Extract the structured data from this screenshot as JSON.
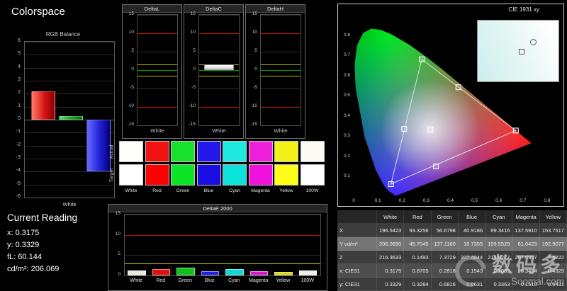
{
  "app": {
    "title": "Colorspace"
  },
  "rgb_balance": {
    "title": "RGB Balance",
    "xlabel": "White",
    "ylim": [
      -6,
      6
    ],
    "ticks": [
      6,
      5,
      4,
      3,
      2,
      1,
      0,
      -1,
      -2,
      -3,
      -4,
      -5,
      -6
    ],
    "bars": [
      {
        "name": "red",
        "value": 2.2,
        "color": "#d81414",
        "color_light": "#ff7a6a",
        "color_dark": "#8a0000"
      },
      {
        "name": "green",
        "value": 0.3,
        "color": "#0ea21a",
        "color_light": "#5ae05a",
        "color_dark": "#046a0c"
      },
      {
        "name": "blue",
        "value": -4.0,
        "color": "#2222d8",
        "color_light": "#6a6aff",
        "color_dark": "#000078"
      }
    ]
  },
  "current_reading": {
    "title": "Current Reading",
    "lines": [
      "x: 0.3175",
      "y: 0.3329",
      "fL: 60.144",
      "cd/m²: 206.069"
    ]
  },
  "delta_scale": {
    "ticks": [
      15,
      10,
      5,
      0,
      -5,
      -10,
      -15
    ],
    "red_lines": [
      10,
      -10
    ],
    "yellow_lines": [
      1.5,
      -1.5
    ],
    "green_lines": [
      0
    ]
  },
  "delta_charts": [
    {
      "title": "DeltaL",
      "xlabel": "White",
      "value": 0
    },
    {
      "title": "DeltaC",
      "xlabel": "White",
      "value": 1.6
    },
    {
      "title": "DeltaH",
      "xlabel": "White",
      "value": 0
    }
  ],
  "swatches": {
    "row_labels": [
      "Actual",
      "Target"
    ],
    "columns": [
      "White",
      "Red",
      "Green",
      "Blue",
      "Cyan",
      "Magenta",
      "Yellow",
      "100W"
    ],
    "actual": [
      "#fdfdfa",
      "#ee1212",
      "#17e12c",
      "#2618e8",
      "#1fe8e0",
      "#ee1fd9",
      "#f2f216",
      "#fbfbf4"
    ],
    "target": [
      "#ffffff",
      "#ff0000",
      "#0ce527",
      "#1a0ee2",
      "#0de2da",
      "#f011dd",
      "#ffff17",
      "#ffffff"
    ]
  },
  "deltae2000": {
    "title": "DeltaE 2000",
    "ticks": [
      15,
      10,
      5,
      0
    ],
    "red_line": 10,
    "yellow_line": 3,
    "categories": [
      "White",
      "Red",
      "Green",
      "Blue",
      "Cyan",
      "Magenta",
      "Yellow",
      "100W"
    ],
    "values": [
      1.3,
      1.6,
      2.0,
      1.1,
      1.6,
      1.0,
      0.8,
      1.3
    ],
    "colors": [
      "#e8e8df",
      "#e01010",
      "#10c020",
      "#2020e0",
      "#10d8d0",
      "#d818c8",
      "#d8d810",
      "#ececec"
    ]
  },
  "cie": {
    "title": "CIE 1931 xy",
    "x_ticks": [
      "0",
      "0.1",
      "0.2",
      "0.3",
      "0.4",
      "0.5",
      "0.6",
      "0.7",
      "0.8"
    ],
    "y_ticks": [
      "0.8",
      "0.7",
      "0.6",
      "0.5",
      "0.4",
      "0.3",
      "0.2",
      "0.1"
    ],
    "gamut_triangle": [
      [
        0.6705,
        0.3284
      ],
      [
        0.2818,
        0.6816
      ],
      [
        0.1543,
        0.0631
      ]
    ],
    "markers": [
      {
        "name": "white",
        "x": 0.3175,
        "y": 0.3329
      },
      {
        "name": "red",
        "x": 0.6705,
        "y": 0.3284
      },
      {
        "name": "green",
        "x": 0.2818,
        "y": 0.6816
      },
      {
        "name": "blue",
        "x": 0.1543,
        "y": 0.0631
      },
      {
        "name": "cyan",
        "x": 0.2089,
        "y": 0.3363
      },
      {
        "name": "magenta",
        "x": 0.3404,
        "y": 0.151
      },
      {
        "name": "yellow",
        "x": 0.4329,
        "y": 0.5431
      }
    ]
  },
  "table": {
    "col_headers": [
      "",
      "White",
      "Red",
      "Green",
      "Blue",
      "Cyan",
      "Magenta",
      "Yellow"
    ],
    "rows": [
      {
        "label": "X",
        "values": [
          "196.5423",
          "93.3256",
          "56.6798",
          "40.9186",
          "99.3416",
          "137.5910",
          "153.7517"
        ]
      },
      {
        "label": "Y cd/m²",
        "values": [
          "206.0690",
          "45.7045",
          "137.1160",
          "16.7355",
          "159.5529",
          "61.0423",
          "192.9077"
        ]
      },
      {
        "label": "Z",
        "values": [
          "216.3633",
          "0.1493",
          "7.3729",
          "207.4844",
          "215.5277",
          "207.6337",
          "7.5222"
        ]
      },
      {
        "label": "x: CIE31",
        "values": [
          "0.3175",
          "0.6705",
          "0.2818",
          "0.1543",
          "0.2089",
          "0.3404",
          "0.4329"
        ]
      },
      {
        "label": "y: CIE31",
        "values": [
          "0.3329",
          "0.3284",
          "0.6816",
          "0.0631",
          "0.3363",
          "0.1510",
          "0.5431"
        ]
      }
    ]
  },
  "watermark": {
    "brand": "数码多",
    "site": "Soomal.com"
  }
}
